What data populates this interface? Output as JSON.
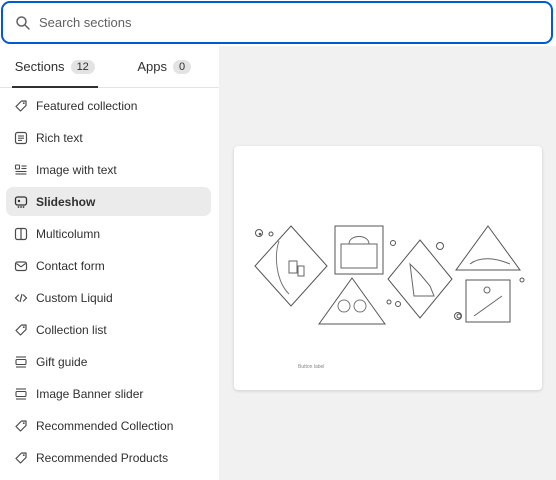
{
  "search": {
    "placeholder": "Search sections"
  },
  "tabs": [
    {
      "label": "Sections",
      "count": "12",
      "active": true
    },
    {
      "label": "Apps",
      "count": "0",
      "active": false
    }
  ],
  "sections": [
    {
      "label": "Featured collection",
      "icon": "tag-icon"
    },
    {
      "label": "Rich text",
      "icon": "text-block-icon"
    },
    {
      "label": "Image with text",
      "icon": "image-with-text-icon"
    },
    {
      "label": "Slideshow",
      "icon": "slideshow-icon",
      "selected": true
    },
    {
      "label": "Multicolumn",
      "icon": "columns-icon"
    },
    {
      "label": "Contact form",
      "icon": "email-icon"
    },
    {
      "label": "Custom Liquid",
      "icon": "code-icon"
    },
    {
      "label": "Collection list",
      "icon": "tag-icon"
    },
    {
      "label": "Gift guide",
      "icon": "layout-icon"
    },
    {
      "label": "Image Banner slider",
      "icon": "layout-icon"
    },
    {
      "label": "Recommended Collection",
      "icon": "tag-icon"
    },
    {
      "label": "Recommended Products",
      "icon": "tag-icon"
    }
  ],
  "preview": {
    "caption": "Button label"
  }
}
